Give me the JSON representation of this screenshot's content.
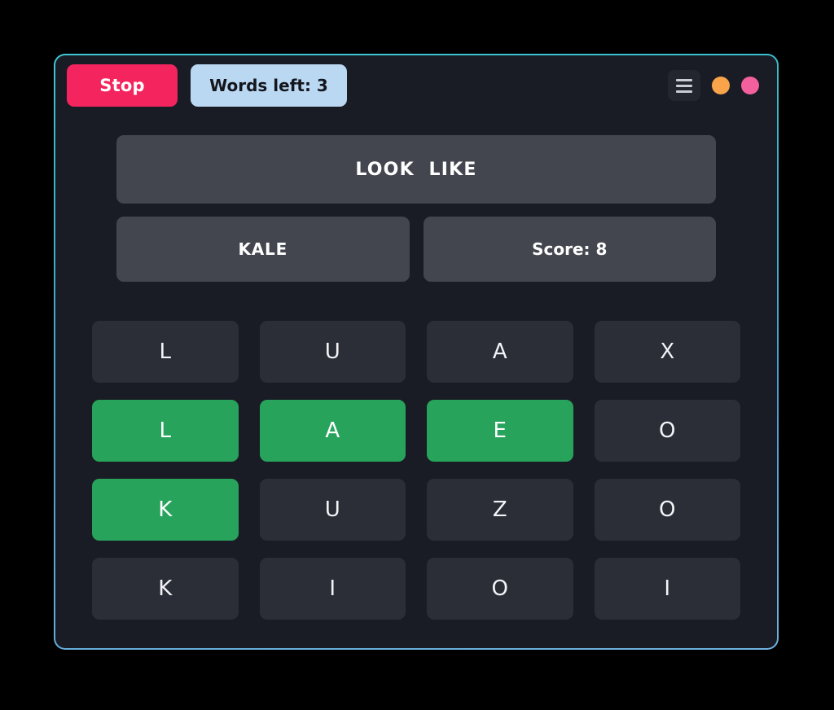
{
  "window": {
    "border_color": "#3fc8d4",
    "background_color": "#1a1c25"
  },
  "toolbar": {
    "stop_label": "Stop",
    "stop_color": "#f4245e",
    "words_left_label": "Words left: 3",
    "words_left_color": "#bbd8f3",
    "menu_icon": "hamburger-menu-icon",
    "minimize_icon": "minimize-circle-icon",
    "minimize_color": "#f9a34a",
    "close_icon": "close-circle-icon",
    "close_color": "#f2609e"
  },
  "panels": {
    "phrase": "LOOK  LIKE",
    "answer": "KALE",
    "score": "Score: 8",
    "panel_color": "#43464f"
  },
  "grid": {
    "selected_color": "#28a35c",
    "tile_color": "#2b2d37",
    "rows": [
      [
        {
          "letter": "L",
          "selected": false
        },
        {
          "letter": "U",
          "selected": false
        },
        {
          "letter": "A",
          "selected": false
        },
        {
          "letter": "X",
          "selected": false
        }
      ],
      [
        {
          "letter": "L",
          "selected": true
        },
        {
          "letter": "A",
          "selected": true
        },
        {
          "letter": "E",
          "selected": true
        },
        {
          "letter": "O",
          "selected": false
        }
      ],
      [
        {
          "letter": "K",
          "selected": true
        },
        {
          "letter": "U",
          "selected": false
        },
        {
          "letter": "Z",
          "selected": false
        },
        {
          "letter": "O",
          "selected": false
        }
      ],
      [
        {
          "letter": "K",
          "selected": false
        },
        {
          "letter": "I",
          "selected": false
        },
        {
          "letter": "O",
          "selected": false
        },
        {
          "letter": "I",
          "selected": false
        }
      ]
    ]
  }
}
